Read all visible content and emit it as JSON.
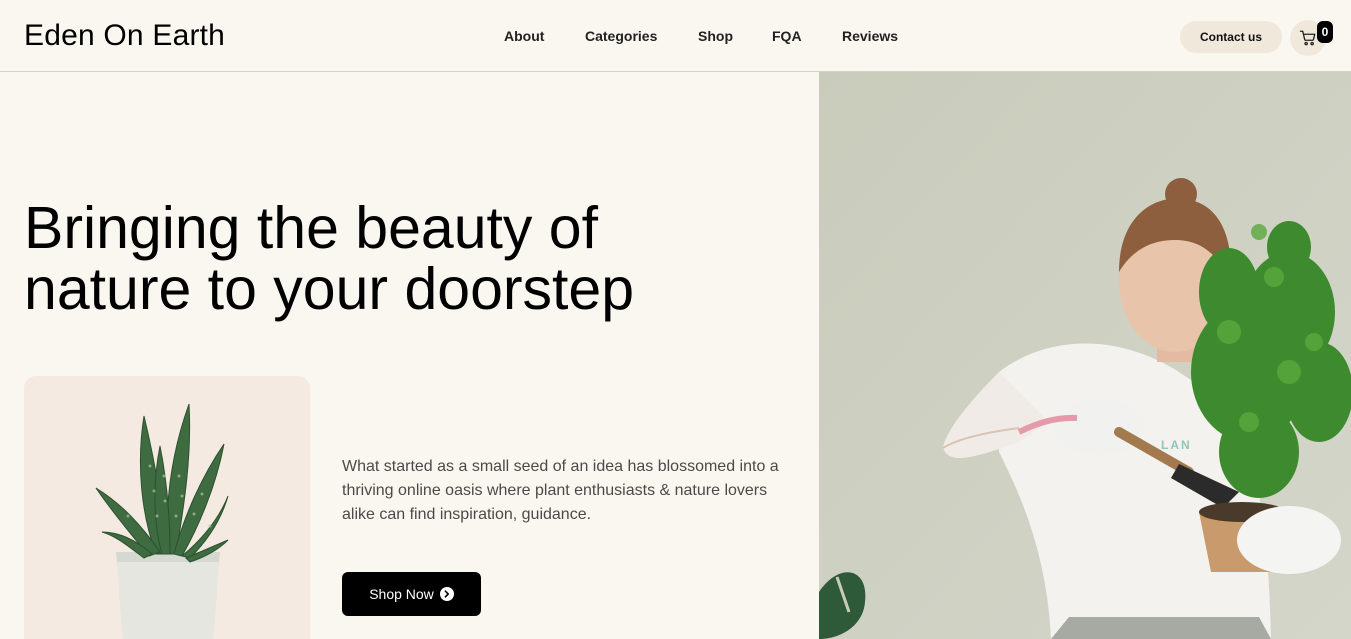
{
  "brand": {
    "name": "Eden On Earth"
  },
  "nav": {
    "items": [
      {
        "label": "About"
      },
      {
        "label": "Categories"
      },
      {
        "label": "Shop"
      },
      {
        "label": "FQA"
      },
      {
        "label": "Reviews"
      }
    ]
  },
  "header": {
    "contact_label": "Contact us",
    "cart_icon": "shopping-cart-icon",
    "cart_count": "0"
  },
  "hero": {
    "title_line1": "Bringing the beauty of",
    "title_line2": "nature to your doorstep",
    "description": "What started as a small seed of an idea has blossomed into a thriving online oasis where plant enthusiasts & nature lovers alike can find inspiration, guidance.",
    "cta_label": "Shop Now",
    "cta_icon": "chevron-right-circle-icon"
  },
  "colors": {
    "page_background": "#faf7f0",
    "header_border": "#d9d2b8",
    "pill_background": "#f1e8dc",
    "plant_card_background": "#f5eae1",
    "cta_background": "#000000",
    "body_text": "#4a4a4a"
  }
}
